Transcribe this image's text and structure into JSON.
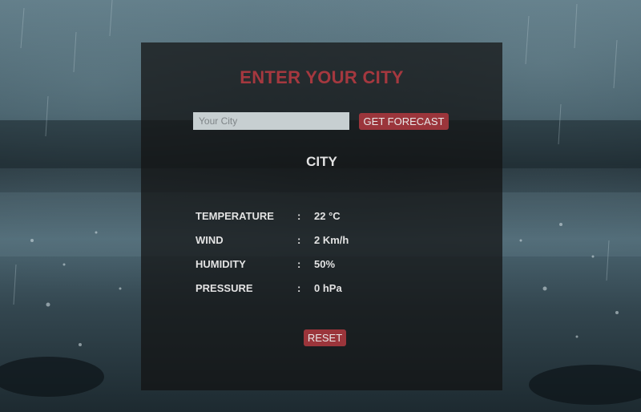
{
  "page": {
    "title": "ENTER YOUR CITY"
  },
  "search": {
    "placeholder": "Your City",
    "value": "",
    "button_label": "GET FORECAST"
  },
  "result": {
    "city": "CITY",
    "stats": [
      {
        "label": "TEMPERATURE",
        "separator": ":",
        "value": "22 °C"
      },
      {
        "label": "WIND",
        "separator": ":",
        "value": "2 Km/h"
      },
      {
        "label": "HUMIDITY",
        "separator": ":",
        "value": "50%"
      },
      {
        "label": "PRESSURE",
        "separator": ":",
        "value": "0 hPa"
      }
    ]
  },
  "actions": {
    "reset_label": "RESET"
  },
  "colors": {
    "accent": "#a5383f",
    "button_bg": "#9b353b",
    "panel_bg": "#121212",
    "text": "#e3e3e3",
    "input_bg": "#c7cfd1"
  }
}
